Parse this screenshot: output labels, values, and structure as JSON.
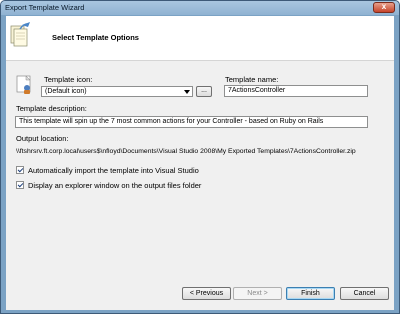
{
  "window": {
    "title": "Export Template Wizard",
    "close_glyph": "x"
  },
  "header": {
    "title": "Select Template Options",
    "icon": "wizard-export-icon"
  },
  "form": {
    "template_icon_label": "Template icon:",
    "template_icon_value": "(Default icon)",
    "browse_label": "...",
    "template_name_label": "Template name:",
    "template_name_value": "7ActionsController",
    "description_label": "Template description:",
    "description_value": "This template will spin up the 7 most common actions for your Controller - based on Ruby on Rails",
    "output_location_label": "Output location:",
    "output_location_value": "\\\\ftshrsrv.ft.corp.local\\users$\\nfloyd\\Documents\\Visual Studio 2008\\My Exported Templates\\7ActionsController.zip",
    "auto_import_label": "Automatically import the template into Visual Studio",
    "auto_import_checked": true,
    "explorer_label": "Display an explorer window on the output files folder",
    "explorer_checked": true
  },
  "buttons": {
    "previous": "< Previous",
    "next": "Next >",
    "finish": "Finish",
    "cancel": "Cancel"
  }
}
